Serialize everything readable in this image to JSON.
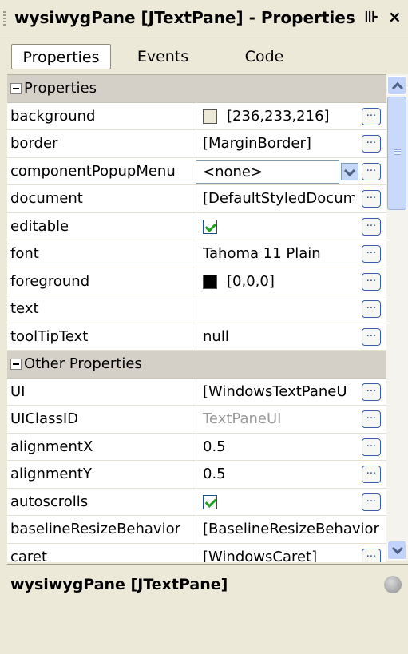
{
  "window": {
    "title": "wysiwygPane [JTextPane] - Properties",
    "controls": {
      "pin": "⊪",
      "close": "×"
    }
  },
  "tabs": [
    {
      "label": "Properties",
      "active": true
    },
    {
      "label": "Events",
      "active": false
    },
    {
      "label": "Code",
      "active": false
    }
  ],
  "categories": {
    "properties": "Properties",
    "other": "Other Properties"
  },
  "properties": [
    {
      "name": "background",
      "value": "[236,233,216]",
      "swatch": "#ece9d8"
    },
    {
      "name": "border",
      "value": "[MarginBorder]"
    },
    {
      "name": "componentPopupMenu",
      "value": "<none>"
    },
    {
      "name": "document",
      "value": "[DefaultStyledDocum"
    },
    {
      "name": "editable",
      "value": "",
      "checked": true
    },
    {
      "name": "font",
      "value": "Tahoma 11 Plain"
    },
    {
      "name": "foreground",
      "value": "[0,0,0]",
      "swatch": "#000000"
    },
    {
      "name": "text",
      "value": ""
    },
    {
      "name": "toolTipText",
      "value": "null"
    }
  ],
  "other_properties": [
    {
      "name": "UI",
      "value": "[WindowsTextPaneU"
    },
    {
      "name": "UIClassID",
      "value": "TextPaneUI"
    },
    {
      "name": "alignmentX",
      "value": "0.5"
    },
    {
      "name": "alignmentY",
      "value": "0.5"
    },
    {
      "name": "autoscrolls",
      "value": "",
      "checked": true
    },
    {
      "name": "baselineResizeBehavior",
      "value": "[BaselineResizeBehavior"
    },
    {
      "name": "caret",
      "value": "[WindowsCaret]"
    }
  ],
  "ellipsis": "...",
  "description": {
    "title": "wysiwygPane [JTextPane]"
  },
  "colors": {
    "panel": "#ece9d8",
    "scrollbar": "#c1d3fb",
    "checkmark": "#21a121"
  }
}
